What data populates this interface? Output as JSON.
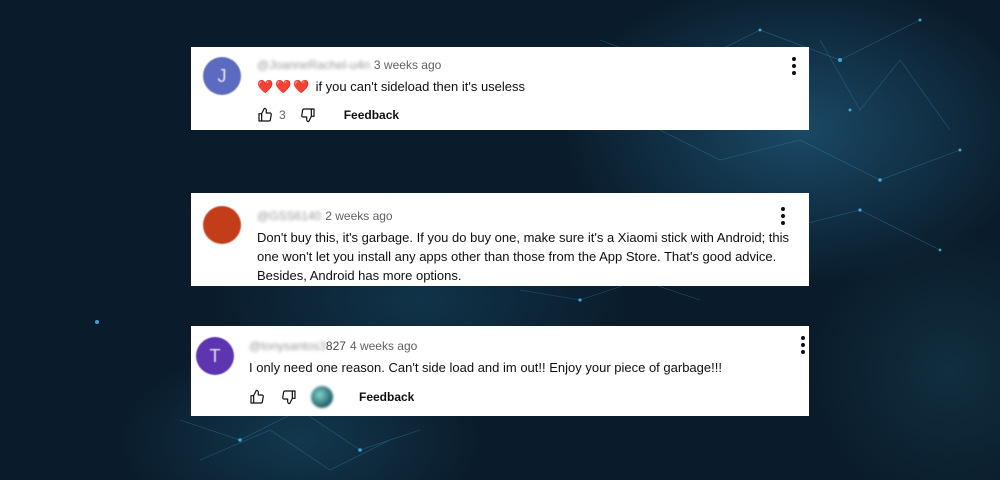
{
  "comments": [
    {
      "handle": "@JoanneRachel-u4n",
      "time": "3 weeks ago",
      "avatar_letter": "J",
      "avatar_color": "#5c6bc0",
      "hearts": "❤️❤️❤️",
      "text": "if you can't sideload then it's useless",
      "like_count": "3",
      "feedback_label": "Feedback"
    },
    {
      "handle": "@GSS6140",
      "time": "2 weeks ago",
      "avatar_color": "#c43d1b",
      "text": "Don't buy this, it's garbage. If you do buy one, make sure it's a Xiaomi stick with Android; this one won't let you install any apps other than those from the App Store. That's good advice. Besides, Android has more options."
    },
    {
      "handle_blurred": "@tonysantos3",
      "handle_visible": "827",
      "time": "4 weeks ago",
      "avatar_letter": "T",
      "avatar_color": "#5e35b1",
      "text": "I only need one reason. Can't side load and im out!! Enjoy your piece of garbage!!!",
      "feedback_label": "Feedback"
    }
  ],
  "icons": [
    "thumbs-up-icon",
    "thumbs-down-icon",
    "more-vert-icon"
  ]
}
